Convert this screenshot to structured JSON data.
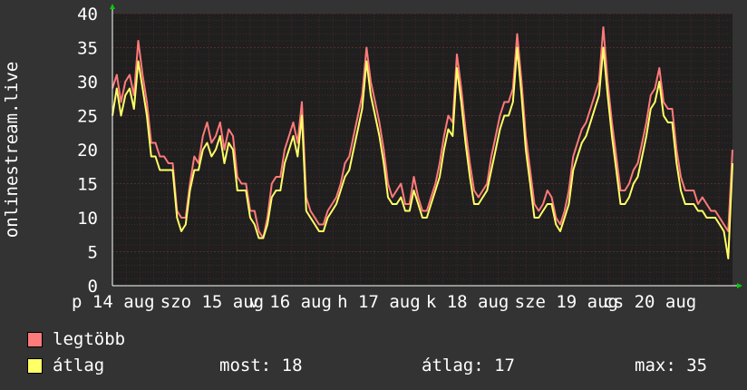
{
  "chart_data": {
    "type": "line",
    "ylabel": "onlinestream.live",
    "ylim": [
      0,
      40
    ],
    "yticks": [
      0,
      5,
      10,
      15,
      20,
      25,
      30,
      35,
      40
    ],
    "x_tick_labels": [
      "p 14 aug",
      "szo 15 aug",
      "v 16 aug",
      "h 17 aug",
      "k 18 aug",
      "sze 19 aug",
      "cs 20 aug"
    ],
    "grid": true,
    "colors": {
      "background": "#333333",
      "plot_bg": "#1f1f1f",
      "grid": "#5a2a2a",
      "axis": "#ffffff",
      "legtobb": "#ff7a7a",
      "atlag": "#ffff66"
    },
    "series": [
      {
        "name": "legtöbb",
        "color": "#ff7a7a",
        "values": [
          29,
          31,
          27,
          30,
          31,
          28,
          36,
          31,
          27,
          21,
          21,
          19,
          19,
          18,
          18,
          11,
          10,
          10,
          15,
          19,
          18,
          22,
          24,
          21,
          22,
          24,
          20,
          23,
          22,
          16,
          15,
          15,
          11,
          11,
          8,
          7,
          10,
          15,
          16,
          16,
          20,
          22,
          24,
          21,
          27,
          13,
          11,
          10,
          9,
          9,
          11,
          12,
          13,
          15,
          18,
          19,
          22,
          25,
          28,
          35,
          30,
          27,
          24,
          20,
          15,
          13,
          14,
          15,
          12,
          12,
          16,
          13,
          11,
          11,
          13,
          15,
          18,
          22,
          25,
          24,
          34,
          29,
          23,
          18,
          14,
          13,
          14,
          15,
          19,
          22,
          25,
          27,
          27,
          29,
          37,
          30,
          22,
          17,
          12,
          11,
          12,
          14,
          13,
          10,
          9,
          11,
          14,
          19,
          21,
          23,
          24,
          26,
          28,
          30,
          38,
          30,
          24,
          19,
          14,
          14,
          15,
          17,
          18,
          21,
          24,
          28,
          29,
          32,
          27,
          26,
          26,
          20,
          16,
          14,
          14,
          14,
          12,
          13,
          12,
          11,
          11,
          10,
          9,
          8,
          20
        ]
      },
      {
        "name": "átlag",
        "color": "#ffff66",
        "values": [
          25,
          29,
          25,
          28,
          29,
          26,
          33,
          29,
          25,
          19,
          19,
          17,
          17,
          17,
          17,
          10,
          8,
          9,
          14,
          17,
          17,
          20,
          21,
          19,
          20,
          22,
          18,
          21,
          20,
          14,
          14,
          14,
          10,
          9,
          7,
          7,
          9,
          13,
          14,
          14,
          18,
          20,
          22,
          19,
          25,
          11,
          10,
          9,
          8,
          8,
          10,
          11,
          12,
          14,
          16,
          17,
          20,
          23,
          26,
          33,
          28,
          25,
          22,
          18,
          13,
          12,
          12,
          13,
          11,
          11,
          14,
          12,
          10,
          10,
          12,
          14,
          16,
          20,
          23,
          22,
          32,
          27,
          21,
          16,
          12,
          12,
          13,
          14,
          17,
          20,
          23,
          25,
          25,
          27,
          35,
          28,
          20,
          15,
          10,
          10,
          11,
          12,
          12,
          9,
          8,
          10,
          12,
          17,
          19,
          21,
          22,
          24,
          26,
          28,
          35,
          28,
          22,
          17,
          12,
          12,
          13,
          15,
          16,
          19,
          22,
          26,
          27,
          30,
          25,
          24,
          24,
          18,
          14,
          12,
          12,
          12,
          11,
          11,
          10,
          10,
          10,
          9,
          8,
          4,
          18
        ]
      }
    ]
  },
  "legend": {
    "items": [
      {
        "label": "legtöbb",
        "color": "#ff7a7a"
      },
      {
        "label": "átlag",
        "color": "#ffff66"
      }
    ]
  },
  "stats": {
    "most": "most: 18",
    "atlag": "átlag: 17",
    "max": "max: 35"
  }
}
